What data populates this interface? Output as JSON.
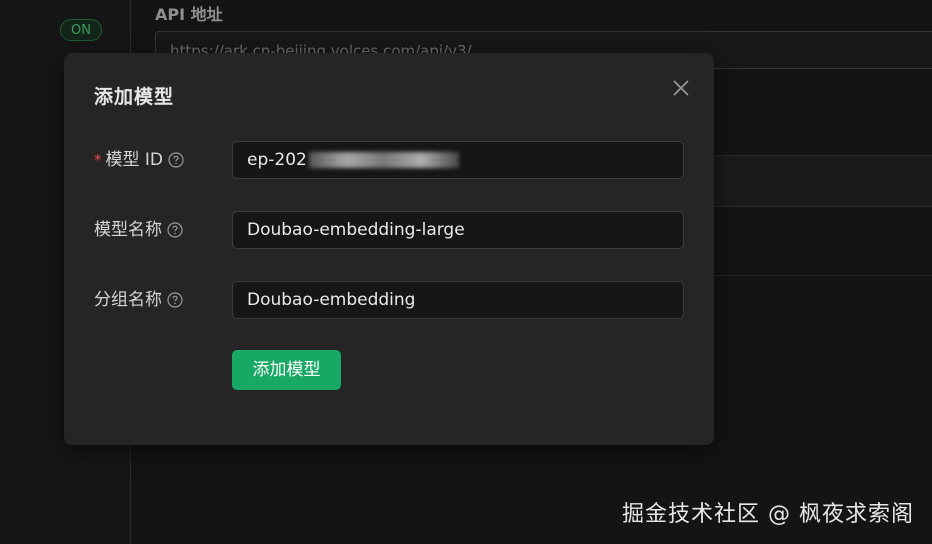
{
  "background": {
    "on_badge": "ON",
    "api_label": "API 地址",
    "api_value": "https://ark.cn-beijing.volces.com/api/v3/"
  },
  "modal": {
    "title": "添加模型",
    "fields": [
      {
        "label": "模型 ID",
        "required": true,
        "value": "ep-202"
      },
      {
        "label": "模型名称",
        "required": false,
        "value": "Doubao-embedding-large"
      },
      {
        "label": "分组名称",
        "required": false,
        "value": "Doubao-embedding"
      }
    ],
    "submit_label": "添加模型",
    "required_mark": "*"
  },
  "watermark": "掘金技术社区 @ 枫夜求索阁",
  "colors": {
    "accent": "#17a863",
    "required": "#e5484d",
    "on_badge": "#3a9e5d"
  }
}
